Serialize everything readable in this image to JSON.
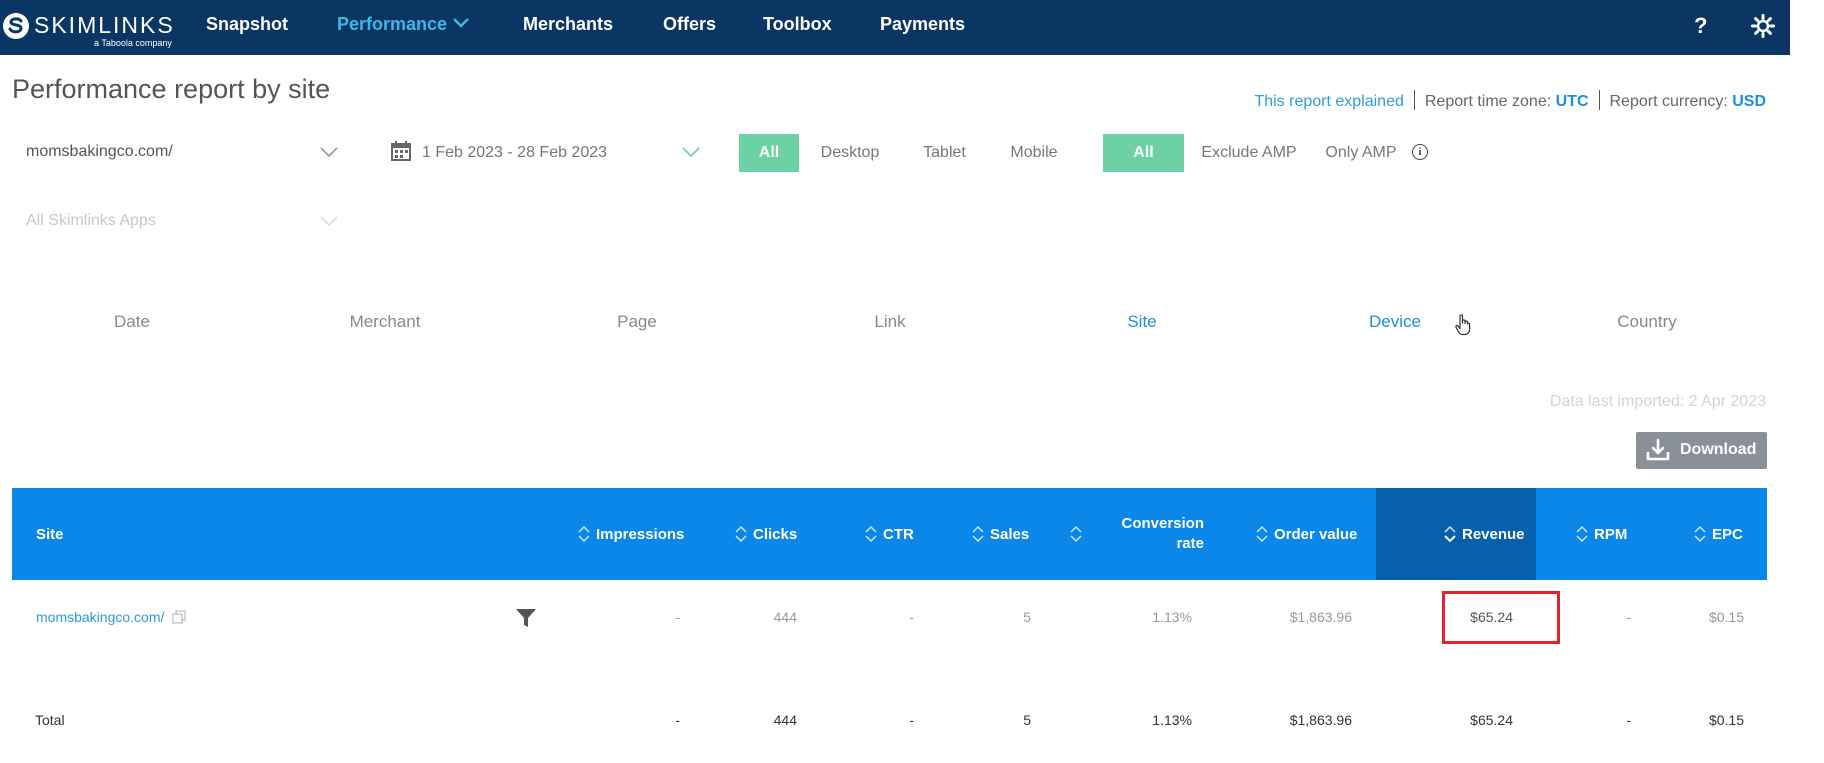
{
  "brand": {
    "name": "SKIMLINKS",
    "tagline": "a Taboola company"
  },
  "nav": {
    "items": [
      {
        "label": "Snapshot",
        "active": false
      },
      {
        "label": "Performance",
        "active": true
      },
      {
        "label": "Merchants",
        "active": false
      },
      {
        "label": "Offers",
        "active": false
      },
      {
        "label": "Toolbox",
        "active": false
      },
      {
        "label": "Payments",
        "active": false
      }
    ],
    "help_icon": "question-mark-icon",
    "settings_icon": "gear-icon"
  },
  "page": {
    "title": "Performance report by site",
    "report_explained": "This report explained",
    "timezone_label": "Report time zone:",
    "timezone_value": "UTC",
    "currency_label": "Report currency:",
    "currency_value": "USD"
  },
  "filters": {
    "site": "momsbakingco.com/",
    "date_range": "1 Feb 2023 - 28 Feb 2023",
    "apps_placeholder": "All Skimlinks Apps",
    "device": [
      "All",
      "Desktop",
      "Tablet",
      "Mobile"
    ],
    "device_selected": "All",
    "amp": [
      "All",
      "Exclude AMP",
      "Only AMP"
    ],
    "amp_selected": "All"
  },
  "tabs": [
    "Date",
    "Merchant",
    "Page",
    "Link",
    "Site",
    "Device",
    "Country"
  ],
  "data_imported": "Data last imported: 2 Apr 2023",
  "download_label": "Download",
  "table": {
    "columns": [
      "Site",
      "Impressions",
      "Clicks",
      "CTR",
      "Sales",
      "Conversion rate",
      "Order value",
      "Revenue",
      "RPM",
      "EPC"
    ],
    "conv_rate_line1": "Conversion",
    "conv_rate_line2": "rate",
    "row": {
      "site": "momsbakingco.com/",
      "impressions": "-",
      "clicks": "444",
      "ctr": "-",
      "sales": "5",
      "conversion_rate": "1.13%",
      "order_value": "$1,863.96",
      "revenue": "$65.24",
      "rpm": "-",
      "epc": "$0.15"
    },
    "total": {
      "label": "Total",
      "impressions": "-",
      "clicks": "444",
      "ctr": "-",
      "sales": "5",
      "conversion_rate": "1.13%",
      "order_value": "$1,863.96",
      "revenue": "$65.24",
      "rpm": "-",
      "epc": "$0.15"
    }
  }
}
